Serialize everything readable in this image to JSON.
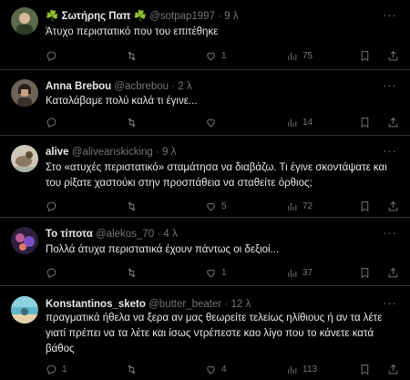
{
  "tweets": [
    {
      "name": "☘️ Σωτήρης Παπ ☘️",
      "handle": "@sotpap1997",
      "sep": "·",
      "time": "9 λ",
      "text": "Άτυχο περιστατικό που του επιτέθηκε",
      "replies": "",
      "retweets": "",
      "likes": "1",
      "views": "75"
    },
    {
      "name": "Anna Brebou",
      "handle": "@acbrebou",
      "sep": "·",
      "time": "2 λ",
      "text": "Καταλάβαμε πολύ καλά τι έγινε...",
      "replies": "",
      "retweets": "",
      "likes": "",
      "views": "14"
    },
    {
      "name": "alive",
      "handle": "@aliveanskicking",
      "sep": "·",
      "time": "9 λ",
      "text": "Στο «ατυχές περιστατικό» σταμάτησα να διαβάζω. Τι έγινε σκοντάψατε και του ρίξατε χαστούκι στην προσπάθεια να σταθείτε όρθιος;",
      "replies": "",
      "retweets": "",
      "likes": "5",
      "views": "72"
    },
    {
      "name": "Το τίποτα",
      "handle": "@alekos_70",
      "sep": "·",
      "time": "4 λ",
      "text": "Πολλά άτυχα περιστατικά έχουν πάντως οι δεξιοί...",
      "replies": "",
      "retweets": "",
      "likes": "1",
      "views": "37"
    },
    {
      "name": "Konstantinos_sketo",
      "handle": "@butter_beater",
      "sep": "·",
      "time": "12 λ",
      "text": "πραγματικά ήθελα να ξερα αν μας θεωρείτε τελείως ηλίθιους ή αν τα λέτε γιατί πρέπει να τα λέτε και ίσως ντρέπεστε καο λίγο που το κάνετε κατά βάθος",
      "replies": "1",
      "retweets": "",
      "likes": "4",
      "views": "113"
    }
  ],
  "icons": {
    "reply": "reply-icon",
    "retweet": "retweet-icon",
    "like": "heart-icon",
    "views": "views-icon",
    "bookmark": "bookmark-icon",
    "share": "share-icon",
    "more": "more-icon"
  },
  "colors": {
    "background": "#000000",
    "text": "#e7e9ea",
    "muted": "#71767b",
    "divider": "#2f3336"
  }
}
